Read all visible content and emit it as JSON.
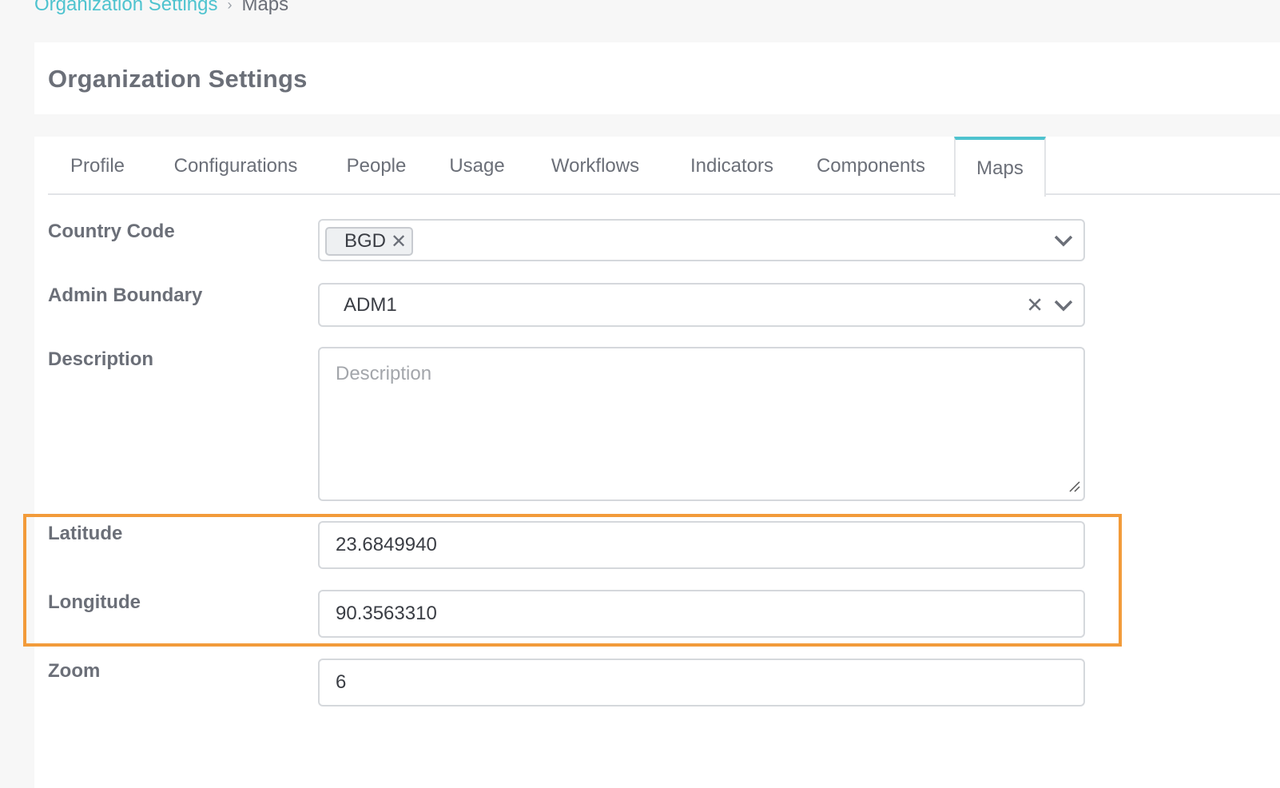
{
  "breadcrumb": {
    "parent": "Organization Settings",
    "separator": "›",
    "current": "Maps"
  },
  "page_title": "Organization Settings",
  "tabs": [
    {
      "label": "Profile"
    },
    {
      "label": "Configurations"
    },
    {
      "label": "People"
    },
    {
      "label": "Usage"
    },
    {
      "label": "Workflows"
    },
    {
      "label": "Indicators"
    },
    {
      "label": "Components"
    },
    {
      "label": "Maps",
      "active": true
    }
  ],
  "form": {
    "country_code": {
      "label": "Country Code",
      "tag": "BGD"
    },
    "admin_boundary": {
      "label": "Admin Boundary",
      "value": "ADM1"
    },
    "description": {
      "label": "Description",
      "placeholder": "Description",
      "value": ""
    },
    "latitude": {
      "label": "Latitude",
      "value": "23.6849940"
    },
    "longitude": {
      "label": "Longitude",
      "value": "90.3563310"
    },
    "zoom": {
      "label": "Zoom",
      "value": "6"
    }
  },
  "colors": {
    "accent": "#4ec3cf",
    "highlight": "#f29b3a"
  }
}
